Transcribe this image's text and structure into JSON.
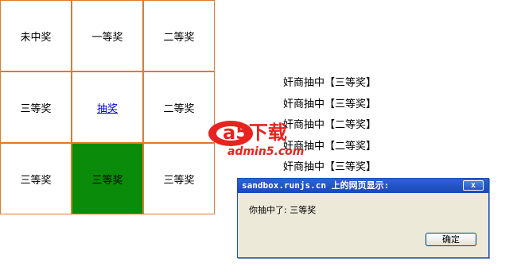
{
  "grid": {
    "cells": [
      "未中奖",
      "一等奖",
      "二等奖",
      "三等奖",
      "抽奖",
      "二等奖",
      "三等奖",
      "三等奖",
      "三等奖"
    ],
    "active_color": "#0a8c0a",
    "border_color": "#e07a2a"
  },
  "results": [
    "奸商抽中【三等奖】",
    "奸商抽中【三等奖】",
    "奸商抽中【二等奖】",
    "奸商抽中【二等奖】",
    "奸商抽中【三等奖】"
  ],
  "watermark": {
    "brand": "a5下载",
    "url": "admin5.com"
  },
  "dialog": {
    "title": "sandbox.runjs.cn 上的网页显示:",
    "close_label": "x",
    "message": "你抽中了: 三等奖",
    "ok_label": "确定"
  }
}
